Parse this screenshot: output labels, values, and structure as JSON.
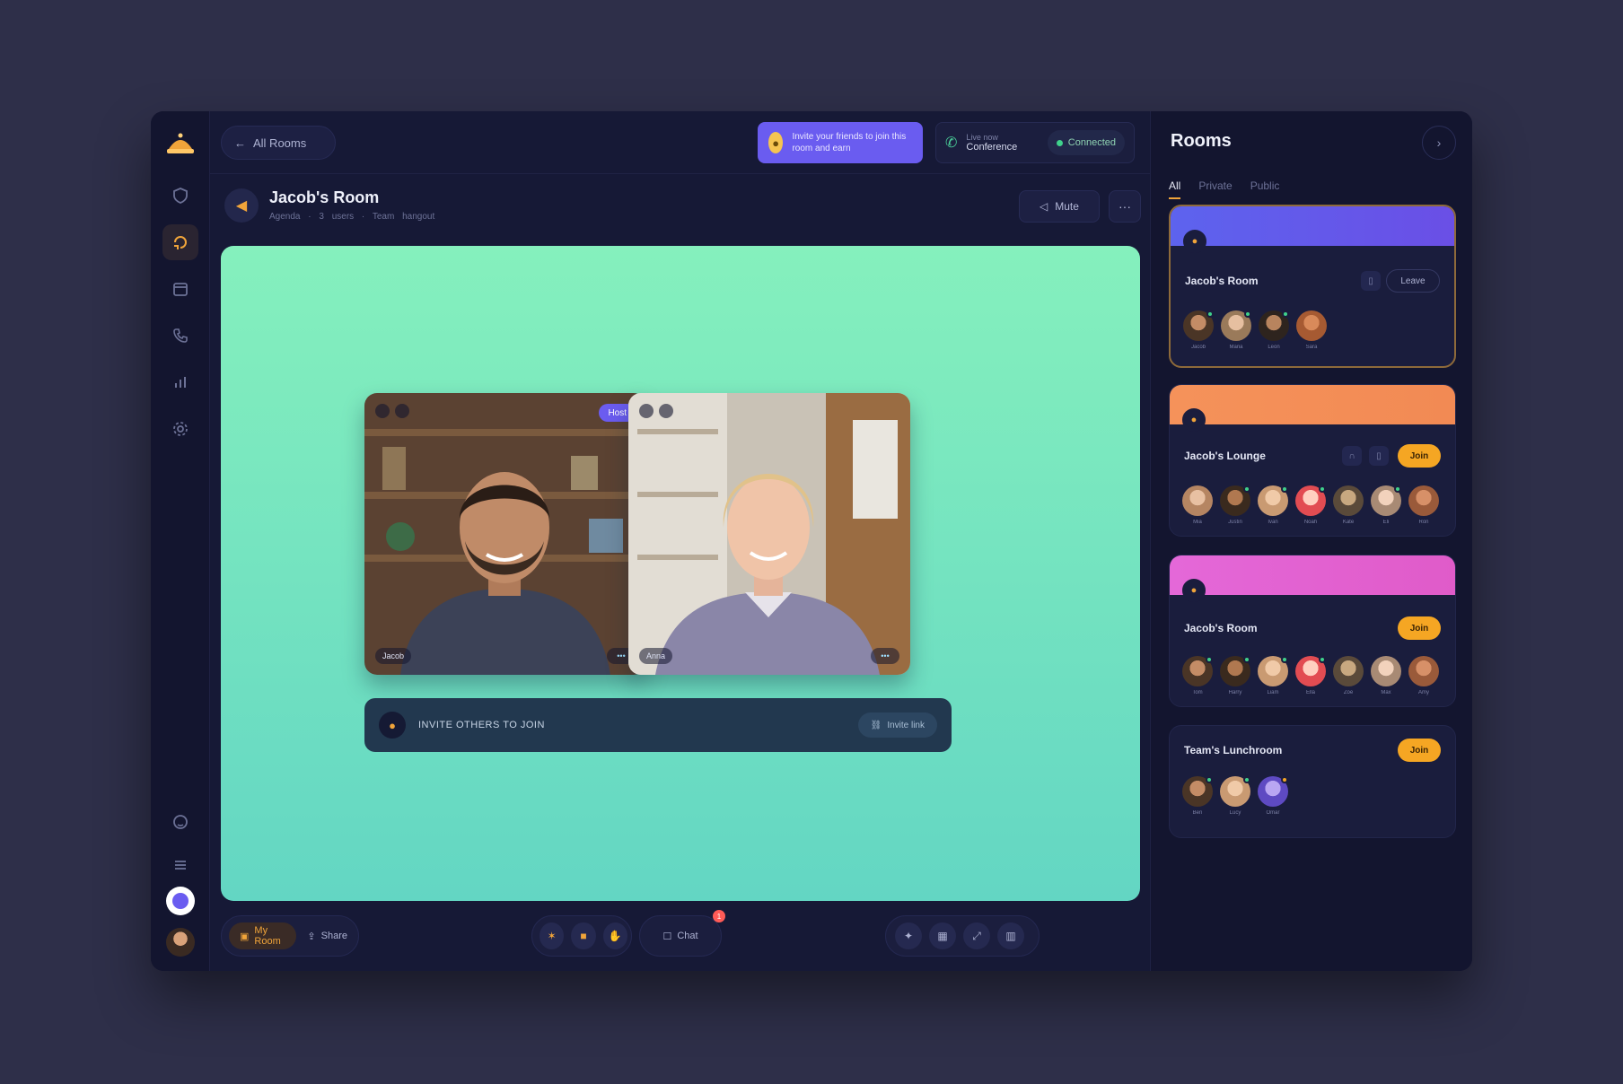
{
  "topbar": {
    "back_label": "All Rooms",
    "promo_text": "Invite your friends to join this room and earn",
    "call_small": "Live now",
    "call_strong": "Conference",
    "call_status": "Connected"
  },
  "room": {
    "title": "Jacob's Room",
    "subtitle": "Agenda · 3 users · Team hangout",
    "mute_label": "Mute",
    "more_label": "···"
  },
  "stage": {
    "tiles": [
      {
        "name": "Jacob",
        "tag": "Host",
        "mic": "•••"
      },
      {
        "name": "Anna",
        "tag": "",
        "mic": "•••"
      }
    ],
    "share_text": "INVITE OTHERS TO JOIN",
    "share_button": "Invite link"
  },
  "bottombar": {
    "room_chip": "My Room",
    "share_chip": "Share",
    "chat_label": "Chat",
    "chat_badge": "1"
  },
  "panel": {
    "title": "Rooms",
    "tabs": [
      "All",
      "Private",
      "Public"
    ],
    "rooms": [
      {
        "name": "Jacob's Room",
        "action": "Leave",
        "people": [
          "Jacob",
          "Maria",
          "Leon",
          "Sara"
        ]
      },
      {
        "name": "Jacob's Lounge",
        "action": "Join",
        "people": [
          "Mia",
          "Justin",
          "Ivan",
          "Noah",
          "Kate",
          "Eli",
          "Ron"
        ]
      },
      {
        "name": "Jacob's Room",
        "action": "Join",
        "people": [
          "Tom",
          "Harry",
          "Liam",
          "Ella",
          "Zoe",
          "Max",
          "Amy"
        ]
      },
      {
        "name": "Team's Lunchroom",
        "action": "Join",
        "people": [
          "Ben",
          "Lucy",
          "Omar"
        ]
      }
    ]
  },
  "colors": {
    "accent": "#f0a43a",
    "primary": "#6a5cf0",
    "stage_top": "#85f0bd",
    "stage_bottom": "#63d6c3",
    "banner_1": "#5d5cf2",
    "banner_2": "#f58f55",
    "banner_3": "#e55fd3"
  }
}
